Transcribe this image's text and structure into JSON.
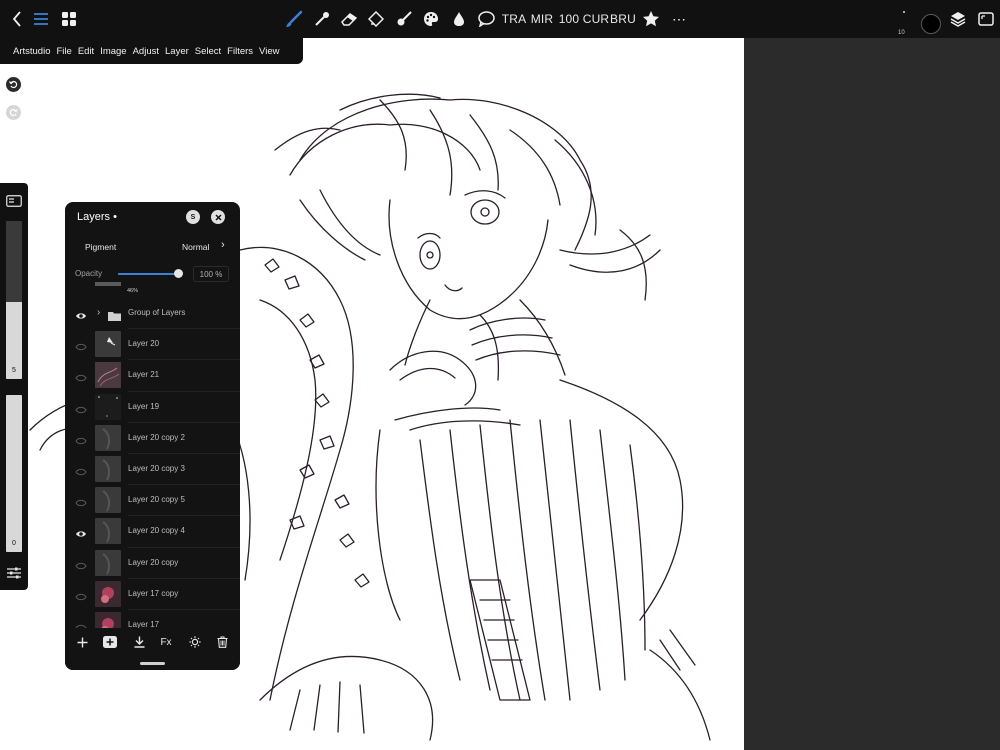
{
  "toolbar": {
    "tools": {
      "tra": "TRA",
      "mir": "MIR",
      "size": "100",
      "cur": "CUR",
      "bru": "BRU"
    },
    "brush_size_small": "10",
    "icons": [
      "back-chevron-icon",
      "list-icon",
      "grid-icon",
      "brush-icon",
      "eyedropper-icon",
      "eraser-icon",
      "transform-icon",
      "paint-brush-icon",
      "palette-icon",
      "drop-icon",
      "speech-bubble-icon",
      "star-icon",
      "more-icon",
      "color-swatch",
      "layers-icon",
      "reference-icon"
    ],
    "accent_color": "#3b82d6"
  },
  "menu": {
    "items": [
      "Artstudio",
      "File",
      "Edit",
      "Image",
      "Adjust",
      "Layer",
      "Select",
      "Filters",
      "View"
    ]
  },
  "left_panel": {
    "size_label": "5",
    "opacity_label": "0",
    "size_fill": 0.49,
    "opacity_fill": 1.0
  },
  "layers_panel": {
    "title": "Layers •",
    "btn_s": "S",
    "blend_left": "Pigment",
    "blend_mode": "Normal",
    "opacity_label": "Opacity",
    "opacity_value": "100 %",
    "opacity_fraction": 1.0,
    "partial_layer_pct": "46%",
    "layers": [
      {
        "name": "Group of Layers",
        "visible": true,
        "folder": true
      },
      {
        "name": "Layer 20",
        "visible": false
      },
      {
        "name": "Layer 21",
        "visible": false
      },
      {
        "name": "Layer 19",
        "visible": false
      },
      {
        "name": "Layer 20 copy 2",
        "visible": false
      },
      {
        "name": "Layer 20 copy 3",
        "visible": false
      },
      {
        "name": "Layer 20 copy 5",
        "visible": false
      },
      {
        "name": "Layer 20 copy 4",
        "visible": true
      },
      {
        "name": "Layer 20 copy",
        "visible": false
      },
      {
        "name": "Layer 17 copy",
        "visible": false
      },
      {
        "name": "Layer 17",
        "visible": false
      }
    ],
    "footer": {
      "fx_label": "Fx"
    }
  }
}
